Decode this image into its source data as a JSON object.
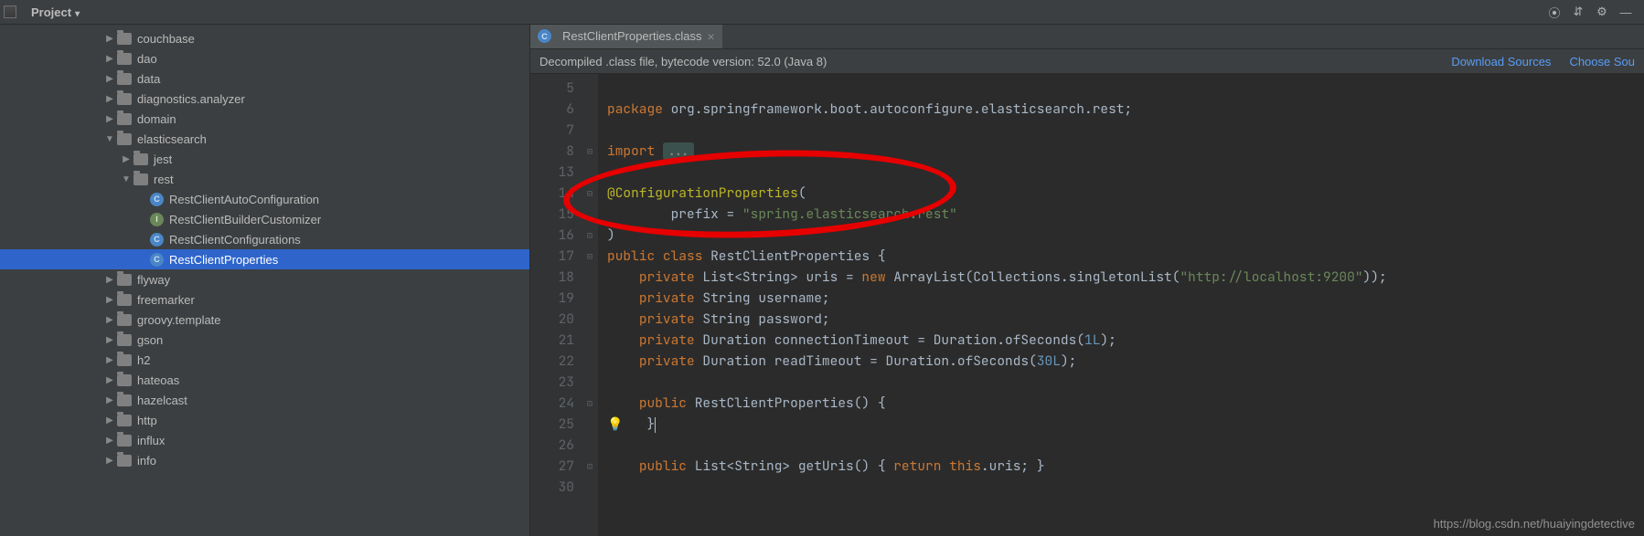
{
  "toolbar": {
    "project": "Project"
  },
  "tree": [
    {
      "depth": 4,
      "exp": "▶",
      "icon": "folder",
      "label": "couchbase"
    },
    {
      "depth": 4,
      "exp": "▶",
      "icon": "folder",
      "label": "dao"
    },
    {
      "depth": 4,
      "exp": "▶",
      "icon": "folder",
      "label": "data"
    },
    {
      "depth": 4,
      "exp": "▶",
      "icon": "folder",
      "label": "diagnostics.analyzer"
    },
    {
      "depth": 4,
      "exp": "▶",
      "icon": "folder",
      "label": "domain"
    },
    {
      "depth": 4,
      "exp": "▼",
      "icon": "folder",
      "label": "elasticsearch"
    },
    {
      "depth": 5,
      "exp": "▶",
      "icon": "folder",
      "label": "jest"
    },
    {
      "depth": 5,
      "exp": "▼",
      "icon": "folder",
      "label": "rest"
    },
    {
      "depth": 6,
      "exp": "",
      "icon": "class-c",
      "label": "RestClientAutoConfiguration"
    },
    {
      "depth": 6,
      "exp": "",
      "icon": "class-i",
      "label": "RestClientBuilderCustomizer"
    },
    {
      "depth": 6,
      "exp": "",
      "icon": "class-c",
      "label": "RestClientConfigurations"
    },
    {
      "depth": 6,
      "exp": "",
      "icon": "class-c",
      "label": "RestClientProperties",
      "sel": true
    },
    {
      "depth": 4,
      "exp": "▶",
      "icon": "folder",
      "label": "flyway"
    },
    {
      "depth": 4,
      "exp": "▶",
      "icon": "folder",
      "label": "freemarker"
    },
    {
      "depth": 4,
      "exp": "▶",
      "icon": "folder",
      "label": "groovy.template"
    },
    {
      "depth": 4,
      "exp": "▶",
      "icon": "folder",
      "label": "gson"
    },
    {
      "depth": 4,
      "exp": "▶",
      "icon": "folder",
      "label": "h2"
    },
    {
      "depth": 4,
      "exp": "▶",
      "icon": "folder",
      "label": "hateoas"
    },
    {
      "depth": 4,
      "exp": "▶",
      "icon": "folder",
      "label": "hazelcast"
    },
    {
      "depth": 4,
      "exp": "▶",
      "icon": "folder",
      "label": "http"
    },
    {
      "depth": 4,
      "exp": "▶",
      "icon": "folder",
      "label": "influx"
    },
    {
      "depth": 4,
      "exp": "▶",
      "icon": "folder",
      "label": "info"
    }
  ],
  "tab": {
    "file": "RestClientProperties.class"
  },
  "banner": {
    "msg": "Decompiled .class file, bytecode version: 52.0 (Java 8)",
    "link1": "Download Sources",
    "link2": "Choose Sou"
  },
  "lines": [
    "5",
    "6",
    "7",
    "8",
    "13",
    "14",
    "15",
    "16",
    "17",
    "18",
    "19",
    "20",
    "21",
    "22",
    "23",
    "24",
    "25",
    "26",
    "27",
    "30"
  ],
  "code": {
    "l6_pkg": "package",
    "l6_path": " org.springframework.boot.autoconfigure.elasticsearch.rest;",
    "l8_import": "import",
    "l8_dots": "...",
    "l14_ann": "@ConfigurationProperties",
    "l14_open": "(",
    "l15_prefix": "prefix = ",
    "l15_str": "\"spring.elasticsearch.rest\"",
    "l16_close": ")",
    "l17_public": "public class",
    "l17_name": " RestClientProperties {",
    "l18_priv": "private",
    "l18_type": " List<String> uris = ",
    "l18_new": "new",
    "l18_rest": " ArrayList(Collections.singletonList(",
    "l18_url": "\"http://localhost:9200\"",
    "l18_end": "));",
    "l19_priv": "private",
    "l19_rest": " String username;",
    "l20_priv": "private",
    "l20_rest": " String password;",
    "l21_priv": "private",
    "l21_rest": " Duration connectionTimeout = Duration.ofSeconds(",
    "l21_num": "1L",
    "l21_end": ");",
    "l22_priv": "private",
    "l22_rest": " Duration readTimeout = Duration.ofSeconds(",
    "l22_num": "30L",
    "l22_end": ");",
    "l24_public": "public",
    "l24_rest": " RestClientProperties() {",
    "l25_close": "}",
    "l27_public": "public",
    "l27_sig": " List<String> getUris() { ",
    "l27_return": "return",
    "l27_this": " this",
    "l27_end": ".uris; }"
  },
  "watermark": "https://blog.csdn.net/huaiyingdetective"
}
